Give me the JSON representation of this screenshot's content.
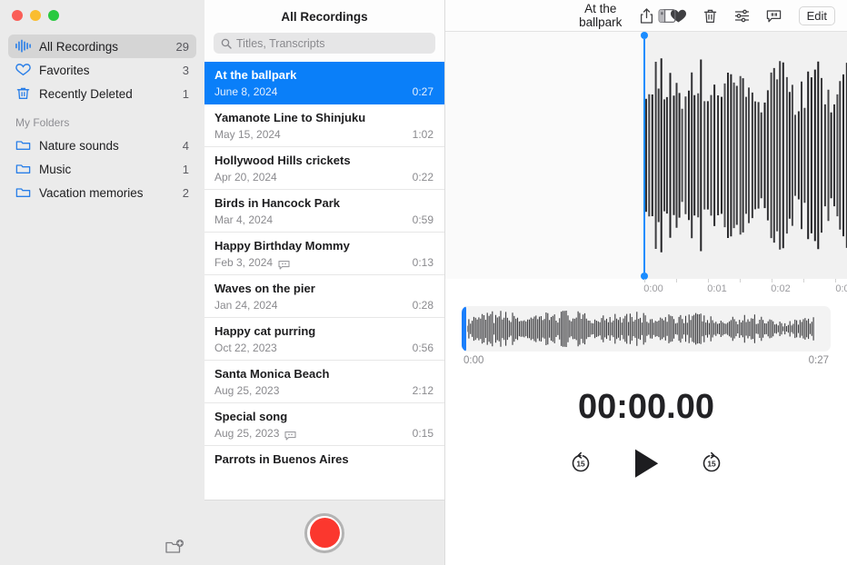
{
  "window": {
    "title": "At the ballpark",
    "traffic_lights": [
      "close",
      "minimize",
      "maximize"
    ]
  },
  "toolbar": {
    "sidebar_toggle_icon": "sidebar-toggle-icon",
    "actions": [
      {
        "name": "share-button",
        "icon": "share-icon"
      },
      {
        "name": "favorite-button",
        "icon": "heart-filled-icon"
      },
      {
        "name": "delete-button",
        "icon": "trash-icon"
      },
      {
        "name": "enhance-button",
        "icon": "sliders-icon"
      },
      {
        "name": "transcript-button",
        "icon": "transcript-bubble-icon"
      }
    ],
    "edit_label": "Edit"
  },
  "sidebar": {
    "items": [
      {
        "label": "All Recordings",
        "count": "29",
        "icon": "waveform-icon",
        "selected": true
      },
      {
        "label": "Favorites",
        "count": "3",
        "icon": "heart-outline-icon",
        "selected": false
      },
      {
        "label": "Recently Deleted",
        "count": "1",
        "icon": "trash-icon",
        "selected": false
      }
    ],
    "group_label": "My Folders",
    "folders": [
      {
        "label": "Nature sounds",
        "count": "4",
        "icon": "folder-icon"
      },
      {
        "label": "Music",
        "count": "1",
        "icon": "folder-icon"
      },
      {
        "label": "Vacation memories",
        "count": "2",
        "icon": "folder-icon"
      }
    ],
    "new_folder_icon": "new-folder-icon",
    "accent": "#2a7fe8",
    "background": "#ebebeb"
  },
  "list": {
    "header": "All Recordings",
    "search": {
      "value": "",
      "placeholder": "Titles, Transcripts",
      "icon": "search-icon"
    },
    "selection_color": "#0a7ff9",
    "recordings": [
      {
        "title": "At the ballpark",
        "date": "June 8, 2024",
        "duration": "0:27",
        "selected": true,
        "transcript": false
      },
      {
        "title": "Yamanote Line to Shinjuku",
        "date": "May 15, 2024",
        "duration": "1:02",
        "selected": false,
        "transcript": false
      },
      {
        "title": "Hollywood Hills crickets",
        "date": "Apr 20, 2024",
        "duration": "0:22",
        "selected": false,
        "transcript": false
      },
      {
        "title": "Birds in Hancock Park",
        "date": "Mar 4, 2024",
        "duration": "0:59",
        "selected": false,
        "transcript": false
      },
      {
        "title": "Happy Birthday Mommy",
        "date": "Feb 3, 2024",
        "duration": "0:13",
        "selected": false,
        "transcript": true
      },
      {
        "title": "Waves on the pier",
        "date": "Jan 24, 2024",
        "duration": "0:28",
        "selected": false,
        "transcript": false
      },
      {
        "title": "Happy cat purring",
        "date": "Oct 22, 2023",
        "duration": "0:56",
        "selected": false,
        "transcript": false
      },
      {
        "title": "Santa Monica Beach",
        "date": "Aug 25, 2023",
        "duration": "2:12",
        "selected": false,
        "transcript": false
      },
      {
        "title": "Special song",
        "date": "Aug 25, 2023",
        "duration": "0:15",
        "selected": false,
        "transcript": true
      },
      {
        "title": "Parrots in Buenos Aires",
        "date": "",
        "duration": "",
        "selected": false,
        "transcript": false
      }
    ],
    "record_button": {
      "name": "record-button",
      "color": "#fb372e"
    }
  },
  "player": {
    "playhead_color": "#1a8cff",
    "playhead_position_label": "0:00",
    "timeline_labels": [
      "0:00",
      "0:01",
      "0:02",
      "0:0"
    ],
    "overview": {
      "start": "0:00",
      "end": "0:27"
    },
    "current_time": "00:00.00",
    "transport": {
      "skip_back_label": "15",
      "skip_back_icon": "skip-back-15-icon",
      "play_icon": "play-icon",
      "skip_forward_label": "15",
      "skip_forward_icon": "skip-forward-15-icon"
    }
  }
}
